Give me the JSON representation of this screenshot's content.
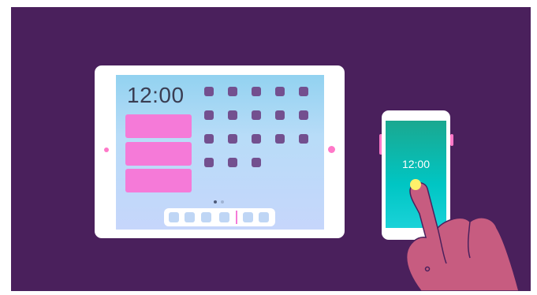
{
  "tablet": {
    "clock": "12:00",
    "widgets": 3,
    "app_icon_grid": [
      5,
      5,
      5,
      3
    ],
    "pages": [
      {
        "active": true
      },
      {
        "active": false
      }
    ],
    "dock_icons": 6
  },
  "phone": {
    "clock": "12:00"
  },
  "colors": {
    "background": "#4a205c",
    "accent_pink": "#f57ad8",
    "app_icon": "#73508f",
    "phone_screen": "#00c6c4",
    "touch_dot": "#fff06a",
    "hand": "#c75c80"
  },
  "icons": [
    "tablet-icon",
    "phone-icon",
    "pointing-hand-icon",
    "touch-dot-icon"
  ]
}
